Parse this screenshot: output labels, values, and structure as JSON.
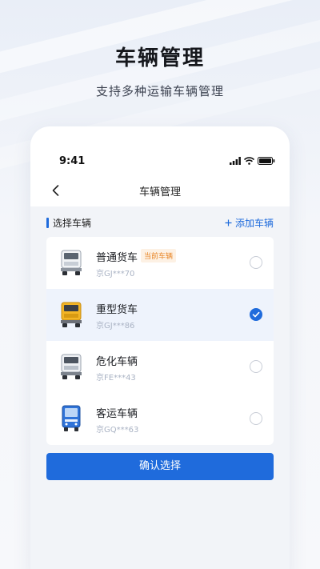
{
  "hero": {
    "title": "车辆管理",
    "subtitle": "支持多种运输车辆管理"
  },
  "status_bar": {
    "time": "9:41"
  },
  "navbar": {
    "title": "车辆管理"
  },
  "section": {
    "title": "选择车辆",
    "add_label": "添加车辆"
  },
  "vehicles": [
    {
      "name": "普通货车",
      "plate": "京GJ***70",
      "tag": "当前车辆",
      "selected": false,
      "icon": "white-truck-icon"
    },
    {
      "name": "重型货车",
      "plate": "京GJ***86",
      "tag": "",
      "selected": true,
      "icon": "yellow-truck-icon"
    },
    {
      "name": "危化车辆",
      "plate": "京FE***43",
      "tag": "",
      "selected": false,
      "icon": "hazmat-truck-icon"
    },
    {
      "name": "客运车辆",
      "plate": "京GQ***63",
      "tag": "",
      "selected": false,
      "icon": "bus-icon"
    }
  ],
  "confirm_label": "确认选择",
  "colors": {
    "accent": "#1f6bdc",
    "tag_text": "#e8872a",
    "tag_bg": "#fdf1e4",
    "selected_row": "#eef3fc"
  }
}
